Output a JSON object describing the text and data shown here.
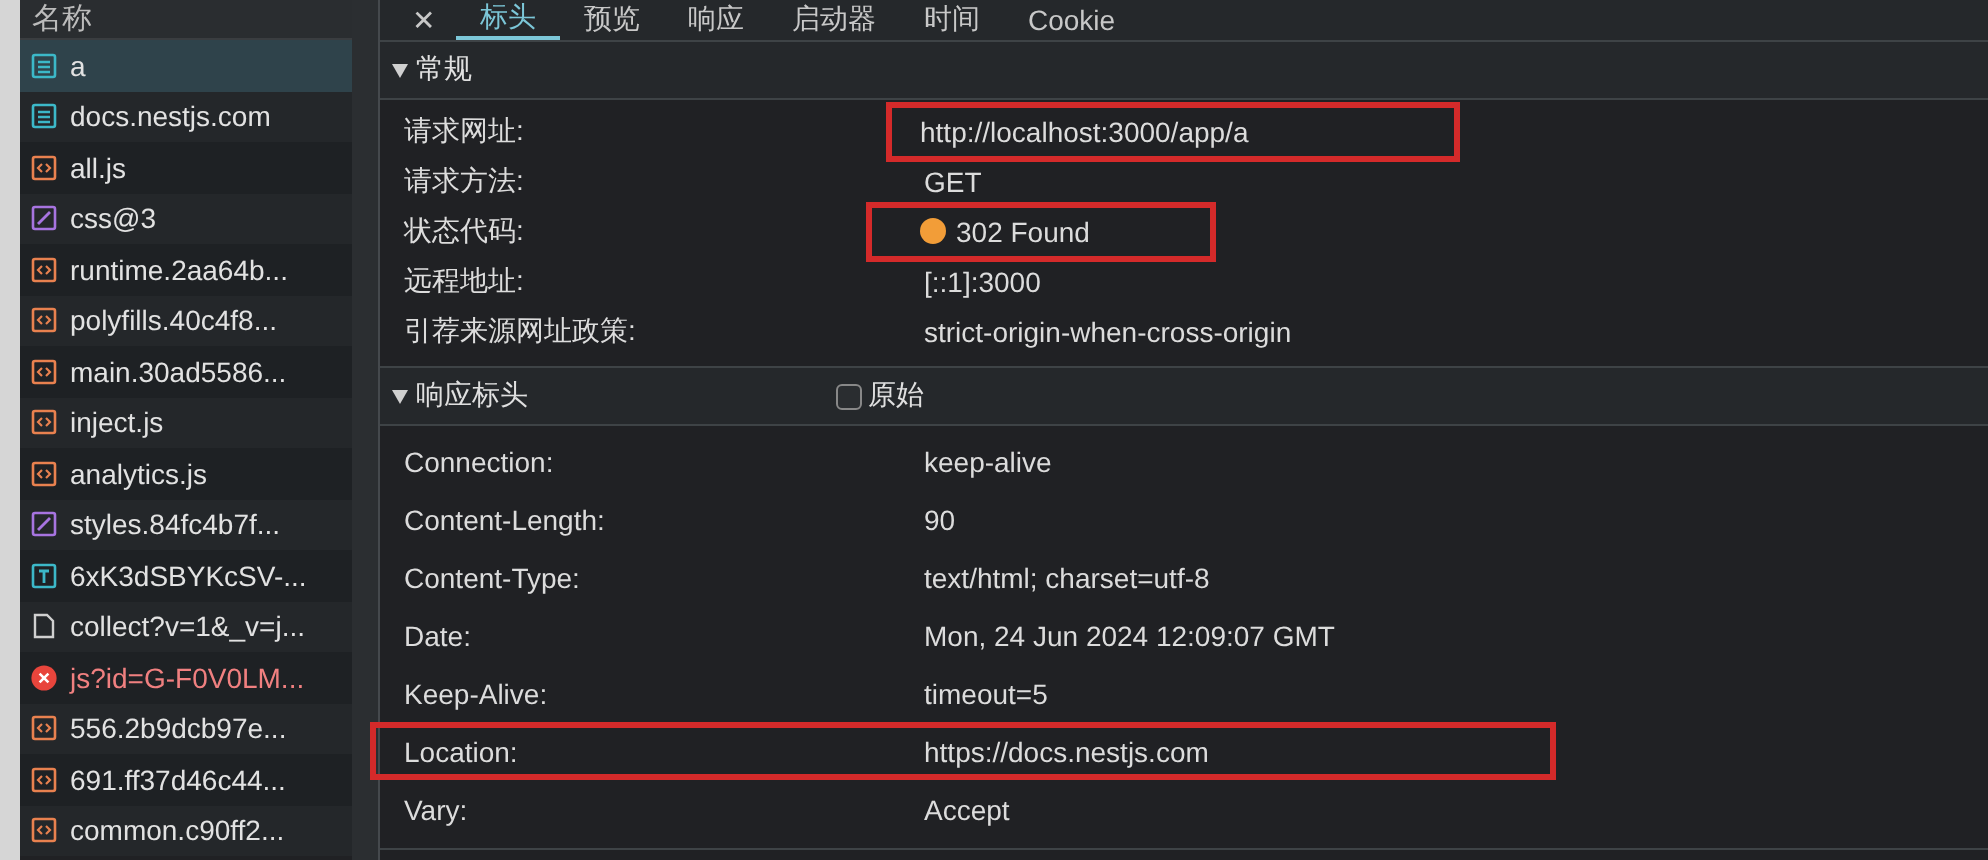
{
  "sidebar": {
    "header": "名称",
    "items": [
      {
        "name": "a",
        "kind": "document",
        "selected": true,
        "error": false
      },
      {
        "name": "docs.nestjs.com",
        "kind": "document",
        "selected": false,
        "error": false
      },
      {
        "name": "all.js",
        "kind": "script",
        "selected": false,
        "error": false
      },
      {
        "name": "css@3",
        "kind": "stylesheet",
        "selected": false,
        "error": false
      },
      {
        "name": "runtime.2aa64b...",
        "kind": "script",
        "selected": false,
        "error": false
      },
      {
        "name": "polyfills.40c4f8...",
        "kind": "script",
        "selected": false,
        "error": false
      },
      {
        "name": "main.30ad5586...",
        "kind": "script",
        "selected": false,
        "error": false
      },
      {
        "name": "inject.js",
        "kind": "script",
        "selected": false,
        "error": false
      },
      {
        "name": "analytics.js",
        "kind": "script",
        "selected": false,
        "error": false
      },
      {
        "name": "styles.84fc4b7f...",
        "kind": "stylesheet",
        "selected": false,
        "error": false
      },
      {
        "name": "6xK3dSBYKcSV-...",
        "kind": "font",
        "selected": false,
        "error": false
      },
      {
        "name": "collect?v=1&_v=j...",
        "kind": "file",
        "selected": false,
        "error": false
      },
      {
        "name": "js?id=G-F0V0LM...",
        "kind": "error",
        "selected": false,
        "error": true
      },
      {
        "name": "556.2b9dcb97e...",
        "kind": "script",
        "selected": false,
        "error": false
      },
      {
        "name": "691.ff37d46c44...",
        "kind": "script",
        "selected": false,
        "error": false
      },
      {
        "name": "common.c90ff2...",
        "kind": "script",
        "selected": false,
        "error": false
      }
    ]
  },
  "close_label": "✕",
  "tabs": [
    {
      "label": "标头",
      "selected": true
    },
    {
      "label": "预览",
      "selected": false
    },
    {
      "label": "响应",
      "selected": false
    },
    {
      "label": "启动器",
      "selected": false
    },
    {
      "label": "时间",
      "selected": false
    },
    {
      "label": "Cookie",
      "selected": false
    }
  ],
  "general": {
    "title": "常规",
    "expanded": true,
    "rows": [
      {
        "label": "请求网址:",
        "value": "http://localhost:3000/app/a",
        "value_highlighted": true
      },
      {
        "label": "请求方法:",
        "value": "GET"
      },
      {
        "label": "状态代码:",
        "value": "302 Found",
        "color": "#f29d38",
        "value_highlighted": true
      },
      {
        "label": "远程地址:",
        "value": "[::1]:3000"
      },
      {
        "label": "引荐来源网址政策:",
        "value": "strict-origin-when-cross-origin"
      }
    ]
  },
  "response_headers": {
    "title": "响应标头",
    "expanded": true,
    "raw_label": "原始",
    "raw_checked": false,
    "rows": [
      {
        "label": "Connection:",
        "value": "keep-alive"
      },
      {
        "label": "Content-Length:",
        "value": "90"
      },
      {
        "label": "Content-Type:",
        "value": "text/html; charset=utf-8"
      },
      {
        "label": "Date:",
        "value": "Mon, 24 Jun 2024 12:09:07 GMT"
      },
      {
        "label": "Keep-Alive:",
        "value": "timeout=5"
      },
      {
        "label": "Location:",
        "value": "https://docs.nestjs.com",
        "row_highlighted": true
      },
      {
        "label": "Vary:",
        "value": "Accept"
      }
    ]
  }
}
